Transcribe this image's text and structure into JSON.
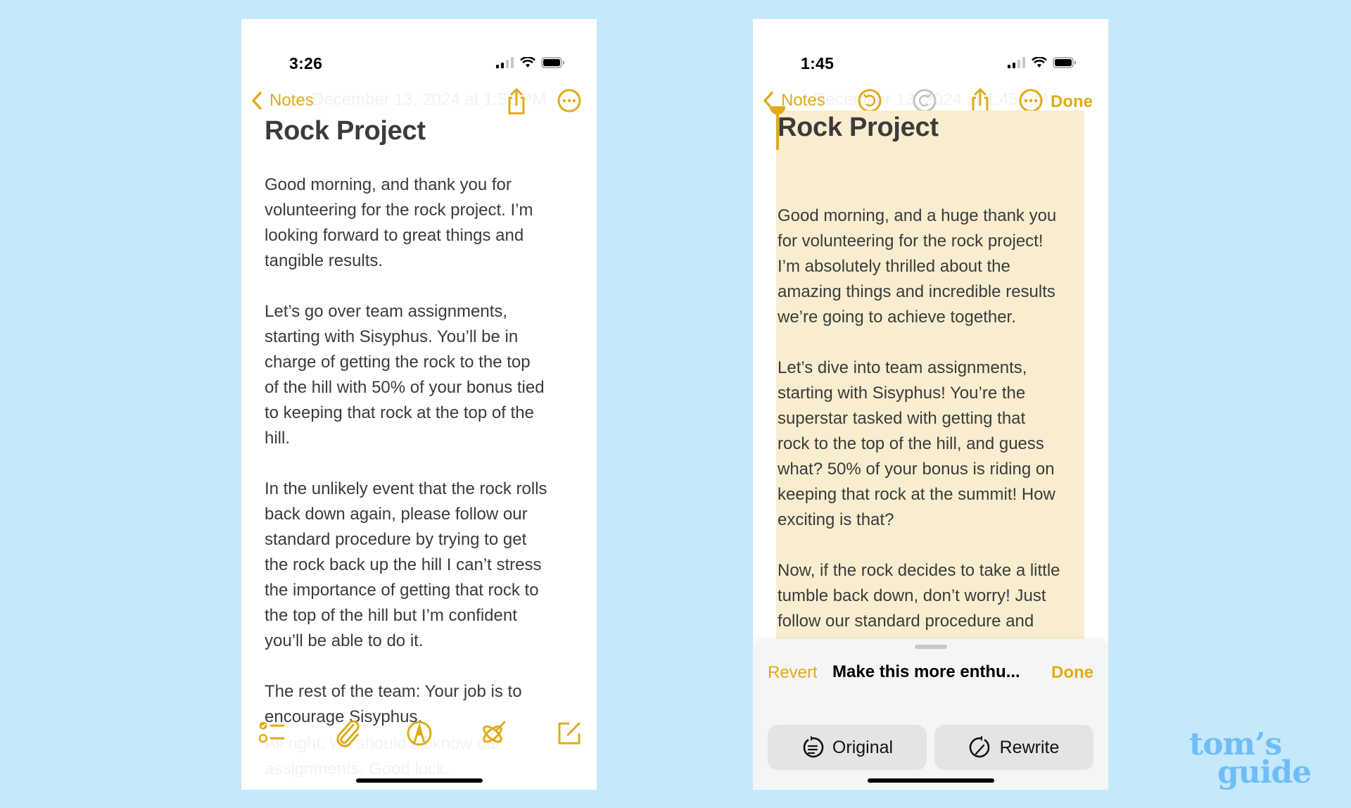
{
  "accent_color": "#e0ab17",
  "background_color": "#c5e8fb",
  "left_phone": {
    "status": {
      "time": "3:26"
    },
    "nav": {
      "back_label": "Notes",
      "faded_date": "December 13, 2024 at 1:52 PM"
    },
    "note": {
      "title": "Rock Project",
      "paragraphs": [
        "Good morning, and thank you for\nvolunteering for the rock project. I’m\nlooking forward to great things and\ntangible results.",
        "Let’s go over team assignments,\nstarting with Sisyphus. You’ll be in\ncharge of getting the rock to the top\nof the hill with 50% of your bonus tied\nto keeping that rock at the top of the\nhill.",
        "In the unlikely event that the rock rolls\nback down again, please follow our\nstandard procedure by trying to get\nthe rock back up the hill I can’t stress\nthe importance of getting that rock to\nthe top of the hill but I’m confident\nyou’ll be able to do it.",
        "The rest of the team: Your job is to\nencourage Sisyphus."
      ],
      "faded_tail": "All right, we should all know our\nassignments. Good luck."
    },
    "toolbar": [
      "checklist-icon",
      "attachment-icon",
      "markup-icon",
      "writing-tools-icon",
      "compose-icon"
    ]
  },
  "right_phone": {
    "status": {
      "time": "1:45"
    },
    "nav": {
      "back_label": "Notes",
      "done_label": "Done",
      "faded_date": "December 13, 2024 at 1:45 PM"
    },
    "note": {
      "title": "Rock Project",
      "paragraphs": [
        "Good morning, and a huge thank you\nfor volunteering for the rock project!\nI’m absolutely thrilled about the\namazing things and incredible results\nwe’re going to achieve together.",
        "Let’s dive into team assignments,\nstarting with Sisyphus! You’re the\nsuperstar tasked with getting that\nrock to the top of the hill, and guess\nwhat? 50% of your bonus is riding on\nkeeping that rock at the summit! How\nexciting is that?",
        "Now, if the rock decides to take a little\ntumble back down, don’t worry! Just\nfollow our standard procedure and\ngive it another go. I can’t emphasize"
      ]
    },
    "sheet": {
      "revert_label": "Revert",
      "title": "Make this more enthu...",
      "done_label": "Done",
      "original_label": "Original",
      "rewrite_label": "Rewrite"
    }
  },
  "watermark": {
    "line1": "tom’s",
    "line2": "guide"
  }
}
